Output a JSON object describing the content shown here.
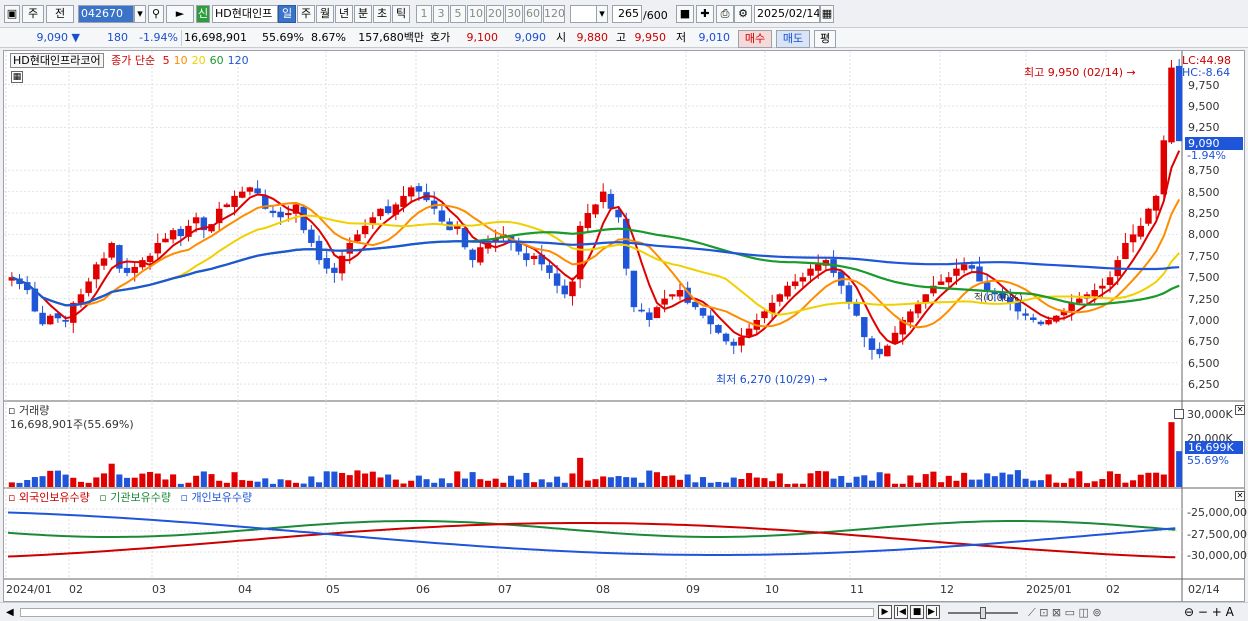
{
  "toolbar": {
    "tab_label": "주",
    "tab_label2": "전",
    "code": "042670",
    "badge": "신",
    "stock_name": "HD현대인프",
    "periods": [
      "일",
      "주",
      "월",
      "년",
      "분",
      "초",
      "틱"
    ],
    "selected_period": "일",
    "counts": [
      "1",
      "3",
      "5",
      "10",
      "20",
      "30",
      "60",
      "120"
    ],
    "range": "265",
    "range_max": "/600",
    "date": "2025/02/14"
  },
  "quote": {
    "price": "9,090",
    "change": "180",
    "change_pct": "-1.94%",
    "volume": "16,698,901",
    "ratio1": "55.69%",
    "ratio2": "8.67%",
    "amount": "157,680백만",
    "bid_label": "호가",
    "bid1": "9,100",
    "bid2": "9,090",
    "open_label": "시",
    "open": "9,880",
    "high_label": "고",
    "high": "9,950",
    "low_label": "저",
    "low": "9,010",
    "buy_label": "매수",
    "sell_label": "매도",
    "eval_label": "평"
  },
  "legend": {
    "name": "HD현대인프라코어",
    "price_label": "종가 단순",
    "ma": [
      "5",
      "10",
      "20",
      "60",
      "120"
    ],
    "ma_colors": [
      "#e00000",
      "#ff8c00",
      "#f0d000",
      "#1a9a2a",
      "#1f55d8"
    ]
  },
  "annotations": {
    "high": "최고 9,950 (02/14)",
    "low": "최저 6,270 (10/29)",
    "lc": "LC:44.98",
    "hc": "HC:-8.64",
    "current_price": "9,090",
    "current_pct": "-1.94%",
    "mid_label": "적(0.00%)"
  },
  "price_axis": [
    "9,750",
    "9,500",
    "9,250",
    "8,750",
    "8,500",
    "8,250",
    "8,000",
    "7,750",
    "7,500",
    "7,250",
    "7,000",
    "6,750",
    "6,500",
    "6,250"
  ],
  "volume_panel": {
    "title": "거래량",
    "value": "16,698,901주(55.69%)",
    "axis": [
      "30,000K",
      "20,000K"
    ],
    "current": "16,699K",
    "current_pct": "55.69%"
  },
  "holding_panel": {
    "series": [
      "외국인보유수량",
      "기관보유수량",
      "개인보유수량"
    ],
    "axis": [
      "-25,000,00",
      "-27,500,00",
      "-30,000,00"
    ]
  },
  "x_axis": [
    "2024/01",
    "02",
    "03",
    "04",
    "05",
    "06",
    "07",
    "08",
    "09",
    "10",
    "11",
    "12",
    "2025/01",
    "02",
    "02/14"
  ],
  "chart_data": {
    "type": "candlestick",
    "title": "HD현대인프라코어",
    "high": 9950,
    "low": 6270,
    "last": 9090,
    "y_range": [
      6100,
      10050
    ],
    "closes": [
      7500,
      7420,
      7350,
      7100,
      6950,
      7050,
      7020,
      6980,
      7200,
      7300,
      7450,
      7650,
      7720,
      7900,
      7600,
      7550,
      7620,
      7700,
      7750,
      7900,
      7950,
      8050,
      7980,
      8100,
      8200,
      8050,
      8120,
      8300,
      8350,
      8450,
      8500,
      8550,
      8480,
      8300,
      8250,
      8200,
      8250,
      8350,
      8050,
      7900,
      7700,
      7600,
      7550,
      7750,
      7900,
      8000,
      8100,
      8200,
      8300,
      8250,
      8350,
      8450,
      8550,
      8500,
      8400,
      8300,
      8150,
      8050,
      8100,
      7850,
      7700,
      7850,
      7900,
      7950,
      8000,
      7900,
      7800,
      7700,
      7750,
      7650,
      7550,
      7400,
      7300,
      7450,
      8100,
      8250,
      8350,
      8500,
      8300,
      8200,
      7600,
      7150,
      7100,
      7000,
      7150,
      7250,
      7300,
      7350,
      7200,
      7150,
      7050,
      6950,
      6850,
      6750,
      6700,
      6800,
      6900,
      7000,
      7100,
      7200,
      7300,
      7400,
      7450,
      7500,
      7600,
      7650,
      7700,
      7550,
      7400,
      7200,
      7050,
      6800,
      6650,
      6600,
      6700,
      6850,
      7000,
      7100,
      7200,
      7300,
      7400,
      7450,
      7500,
      7600,
      7650,
      7600,
      7450,
      7350,
      7300,
      7250,
      7200,
      7100,
      7050,
      7000,
      6950,
      7000,
      7050,
      7100,
      7200,
      7250,
      7300,
      7350,
      7400,
      7500,
      7700,
      7900,
      8000,
      8100,
      8300,
      8450,
      9100,
      9950,
      9090
    ],
    "ma_series": [
      "MA5",
      "MA10",
      "MA20",
      "MA60",
      "MA120"
    ]
  }
}
